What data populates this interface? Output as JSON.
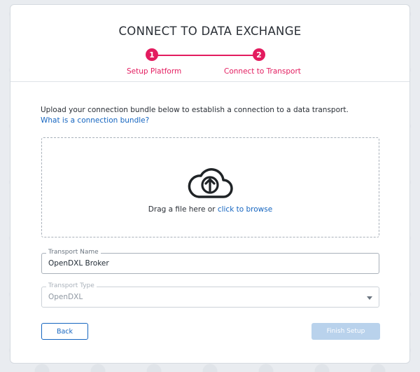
{
  "header": {
    "title": "CONNECT TO DATA EXCHANGE",
    "steps": [
      {
        "number": "1",
        "label": "Setup Platform"
      },
      {
        "number": "2",
        "label": "Connect to Transport"
      }
    ]
  },
  "intro": {
    "text": "Upload your connection bundle below to establish a connection to a data transport.",
    "link": "What is a connection bundle?"
  },
  "dropzone": {
    "icon": "cloud-upload-icon",
    "text": "Drag a file here or",
    "link": "click to browse"
  },
  "transport_name": {
    "label": "Transport Name",
    "value": "OpenDXL Broker"
  },
  "transport_type": {
    "label": "Transport Type",
    "value": "OpenDXL"
  },
  "buttons": {
    "back": "Back",
    "finish": "Finish Setup"
  },
  "colors": {
    "accent": "#e31c5f",
    "link": "#1565c0",
    "disabled_button": "#b9d2ec"
  }
}
